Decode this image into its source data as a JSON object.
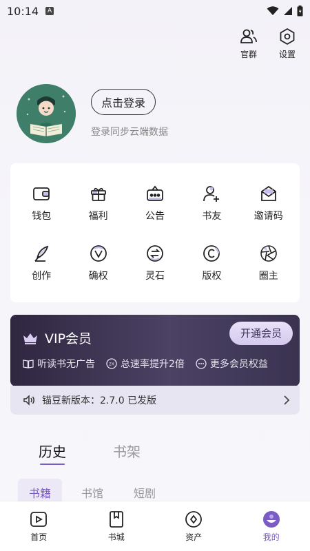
{
  "status": {
    "time": "10:14",
    "notif": "A"
  },
  "top_actions": [
    {
      "label": "官群",
      "icon": "group-icon"
    },
    {
      "label": "设置",
      "icon": "settings-icon"
    }
  ],
  "profile": {
    "login_label": "点击登录",
    "subtitle": "登录同步云端数据"
  },
  "grid": [
    {
      "label": "钱包",
      "icon": "wallet-icon"
    },
    {
      "label": "福利",
      "icon": "gift-icon"
    },
    {
      "label": "公告",
      "icon": "announcement-icon"
    },
    {
      "label": "书友",
      "icon": "add-friend-icon"
    },
    {
      "label": "邀请码",
      "icon": "invite-icon"
    },
    {
      "label": "创作",
      "icon": "quill-icon"
    },
    {
      "label": "确权",
      "icon": "verify-icon"
    },
    {
      "label": "灵石",
      "icon": "spirit-stone-icon"
    },
    {
      "label": "版权",
      "icon": "copyright-icon"
    },
    {
      "label": "圈主",
      "icon": "aperture-icon"
    }
  ],
  "vip": {
    "title": "VIP会员",
    "open_label": "开通会员",
    "features": [
      "听读书无广告",
      "总速率提升2倍",
      "更多会员权益"
    ],
    "badge_2x": "2X"
  },
  "notice": {
    "text": "锚豆新版本：2.7.0 已发版"
  },
  "tabs_main": [
    {
      "label": "历史",
      "active": true
    },
    {
      "label": "书架",
      "active": false
    }
  ],
  "subtabs": [
    {
      "label": "书籍",
      "active": true
    },
    {
      "label": "书馆",
      "active": false
    },
    {
      "label": "短剧",
      "active": false
    }
  ],
  "bottom_nav": [
    {
      "label": "首页",
      "icon": "play-icon"
    },
    {
      "label": "书城",
      "icon": "bookmark-book-icon"
    },
    {
      "label": "资产",
      "icon": "asset-icon"
    },
    {
      "label": "我的",
      "icon": "profile-icon",
      "active": true
    }
  ],
  "colors": {
    "accent": "#7b5cc4",
    "vip_dark": "#2f2740",
    "notice_bg": "#e8e5f2"
  }
}
